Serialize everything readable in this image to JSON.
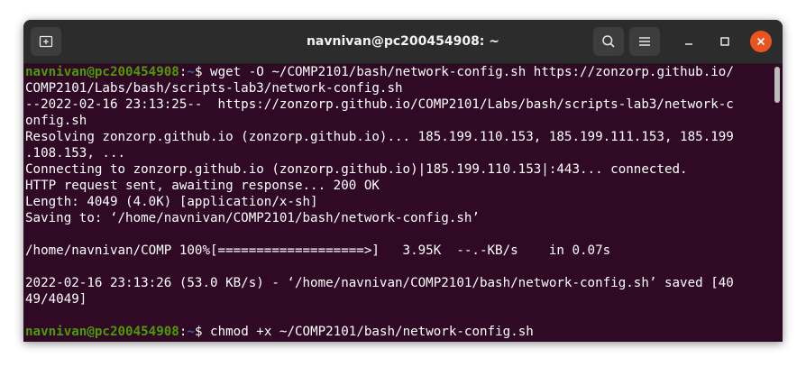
{
  "window": {
    "title": "navnivan@pc200454908: ~"
  },
  "icons": {
    "new_tab": "new-tab-icon",
    "search": "search-icon",
    "menu": "hamburger-menu-icon",
    "minimize": "minimize-icon",
    "maximize": "maximize-icon",
    "close": "close-icon"
  },
  "colors": {
    "terminal_bg": "#300a24",
    "prompt_user": "#4e9a06",
    "prompt_path": "#3465a4",
    "close_button": "#e95420"
  },
  "terminal": {
    "prompt1": {
      "user": "navnivan@pc200454908",
      "sep": ":",
      "path": "~",
      "sym": "$ ",
      "cmd": "wget -O ~/COMP2101/bash/network-config.sh https://zonzorp.github.io/"
    },
    "lines": [
      "COMP2101/Labs/bash/scripts-lab3/network-config.sh",
      "--2022-02-16 23:13:25--  https://zonzorp.github.io/COMP2101/Labs/bash/scripts-lab3/network-c",
      "onfig.sh",
      "Resolving zonzorp.github.io (zonzorp.github.io)... 185.199.110.153, 185.199.111.153, 185.199",
      ".108.153, ...",
      "Connecting to zonzorp.github.io (zonzorp.github.io)|185.199.110.153|:443... connected.",
      "HTTP request sent, awaiting response... 200 OK",
      "Length: 4049 (4.0K) [application/x-sh]",
      "Saving to: ‘/home/navnivan/COMP2101/bash/network-config.sh’",
      "",
      "/home/navnivan/COMP 100%[===================>]   3.95K  --.-KB/s    in 0.07s",
      "",
      "2022-02-16 23:13:26 (53.0 KB/s) - ‘/home/navnivan/COMP2101/bash/network-config.sh’ saved [40",
      "49/4049]",
      ""
    ],
    "prompt2": {
      "user": "navnivan@pc200454908",
      "sep": ":",
      "path": "~",
      "sym": "$ ",
      "cmd": "chmod +x ~/COMP2101/bash/network-config.sh"
    }
  }
}
